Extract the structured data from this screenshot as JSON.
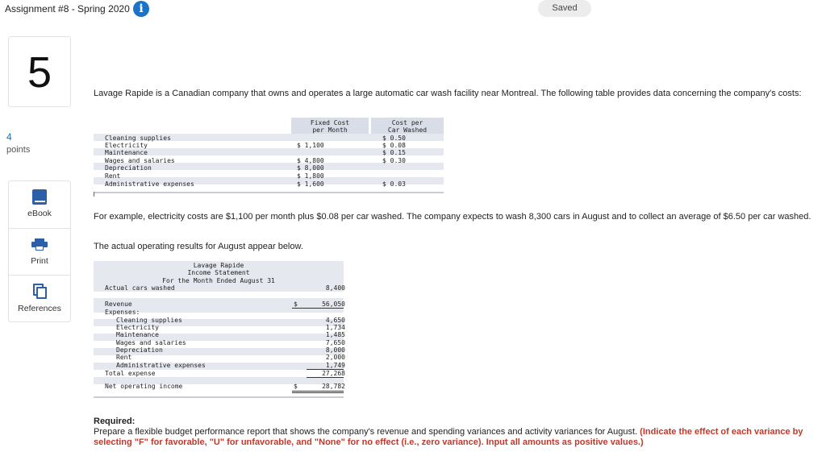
{
  "header": {
    "assignment_title": "Assignment #8 - Spring 2020",
    "info_icon": "info-icon",
    "saved_label": "Saved"
  },
  "question": {
    "number": "5",
    "points_value": "4",
    "points_label": "points"
  },
  "tools": [
    {
      "label": "eBook",
      "icon": "book-icon"
    },
    {
      "label": "Print",
      "icon": "printer-icon"
    },
    {
      "label": "References",
      "icon": "documents-icon"
    }
  ],
  "intro_text": "Lavage Rapide is a Canadian company that owns and operates a large automatic car wash facility near Montreal. The following table provides data concerning the company's costs:",
  "cost_table": {
    "header_fixed_1": "Fixed Cost",
    "header_fixed_2": "per Month",
    "header_var_1": "Cost per",
    "header_var_2": "Car Washed",
    "rows": [
      {
        "item": "Cleaning supplies",
        "fixed": "",
        "variable": "$ 0.50"
      },
      {
        "item": "Electricity",
        "fixed": "$ 1,100",
        "variable": "$ 0.08"
      },
      {
        "item": "Maintenance",
        "fixed": "",
        "variable": "$ 0.15"
      },
      {
        "item": "Wages and salaries",
        "fixed": "$ 4,800",
        "variable": "$ 0.30"
      },
      {
        "item": "Depreciation",
        "fixed": "$ 8,000",
        "variable": ""
      },
      {
        "item": "Rent",
        "fixed": "$ 1,800",
        "variable": ""
      },
      {
        "item": "Administrative expenses",
        "fixed": "$ 1,600",
        "variable": "$ 0.03"
      }
    ]
  },
  "example_text": "For example, electricity costs are $1,100 per month plus $0.08 per car washed. The company expects to wash 8,300 cars in August and to collect an average of $6.50 per car washed.",
  "actual_intro": "The actual operating results for August appear below.",
  "income_statement": {
    "title_1": "Lavage Rapide",
    "title_2": "Income Statement",
    "title_3": "For the Month Ended August 31",
    "actual_cars_label": "Actual cars washed",
    "actual_cars_value": "8,400",
    "revenue_label": "Revenue",
    "revenue_dollar": "$",
    "revenue_value": "56,050",
    "expenses_label": "Expenses:",
    "expenses": [
      {
        "item": "Cleaning supplies",
        "value": "4,650"
      },
      {
        "item": "Electricity",
        "value": "1,734"
      },
      {
        "item": "Maintenance",
        "value": "1,485"
      },
      {
        "item": "Wages and salaries",
        "value": "7,650"
      },
      {
        "item": "Depreciation",
        "value": "8,000"
      },
      {
        "item": "Rent",
        "value": "2,000"
      },
      {
        "item": "Administrative expenses",
        "value": "1,749"
      }
    ],
    "total_label": "Total expense",
    "total_value": "27,268",
    "noi_label": "Net operating income",
    "noi_dollar": "$",
    "noi_value": "28,782"
  },
  "required": {
    "title": "Required:",
    "text": "Prepare a flexible budget performance report that shows the company's revenue and spending variances and activity variances for August.",
    "note": "(Indicate the effect of each variance by selecting \"F\" for favorable, \"U\" for unfavorable, and \"None\" for no effect (i.e., zero variance). Input all amounts as positive values.)"
  },
  "colors": {
    "accent_blue": "#1a73c9",
    "icon_blue": "#2c5fa8",
    "note_red": "#c0392b",
    "table_band": "#e5e8ee"
  }
}
